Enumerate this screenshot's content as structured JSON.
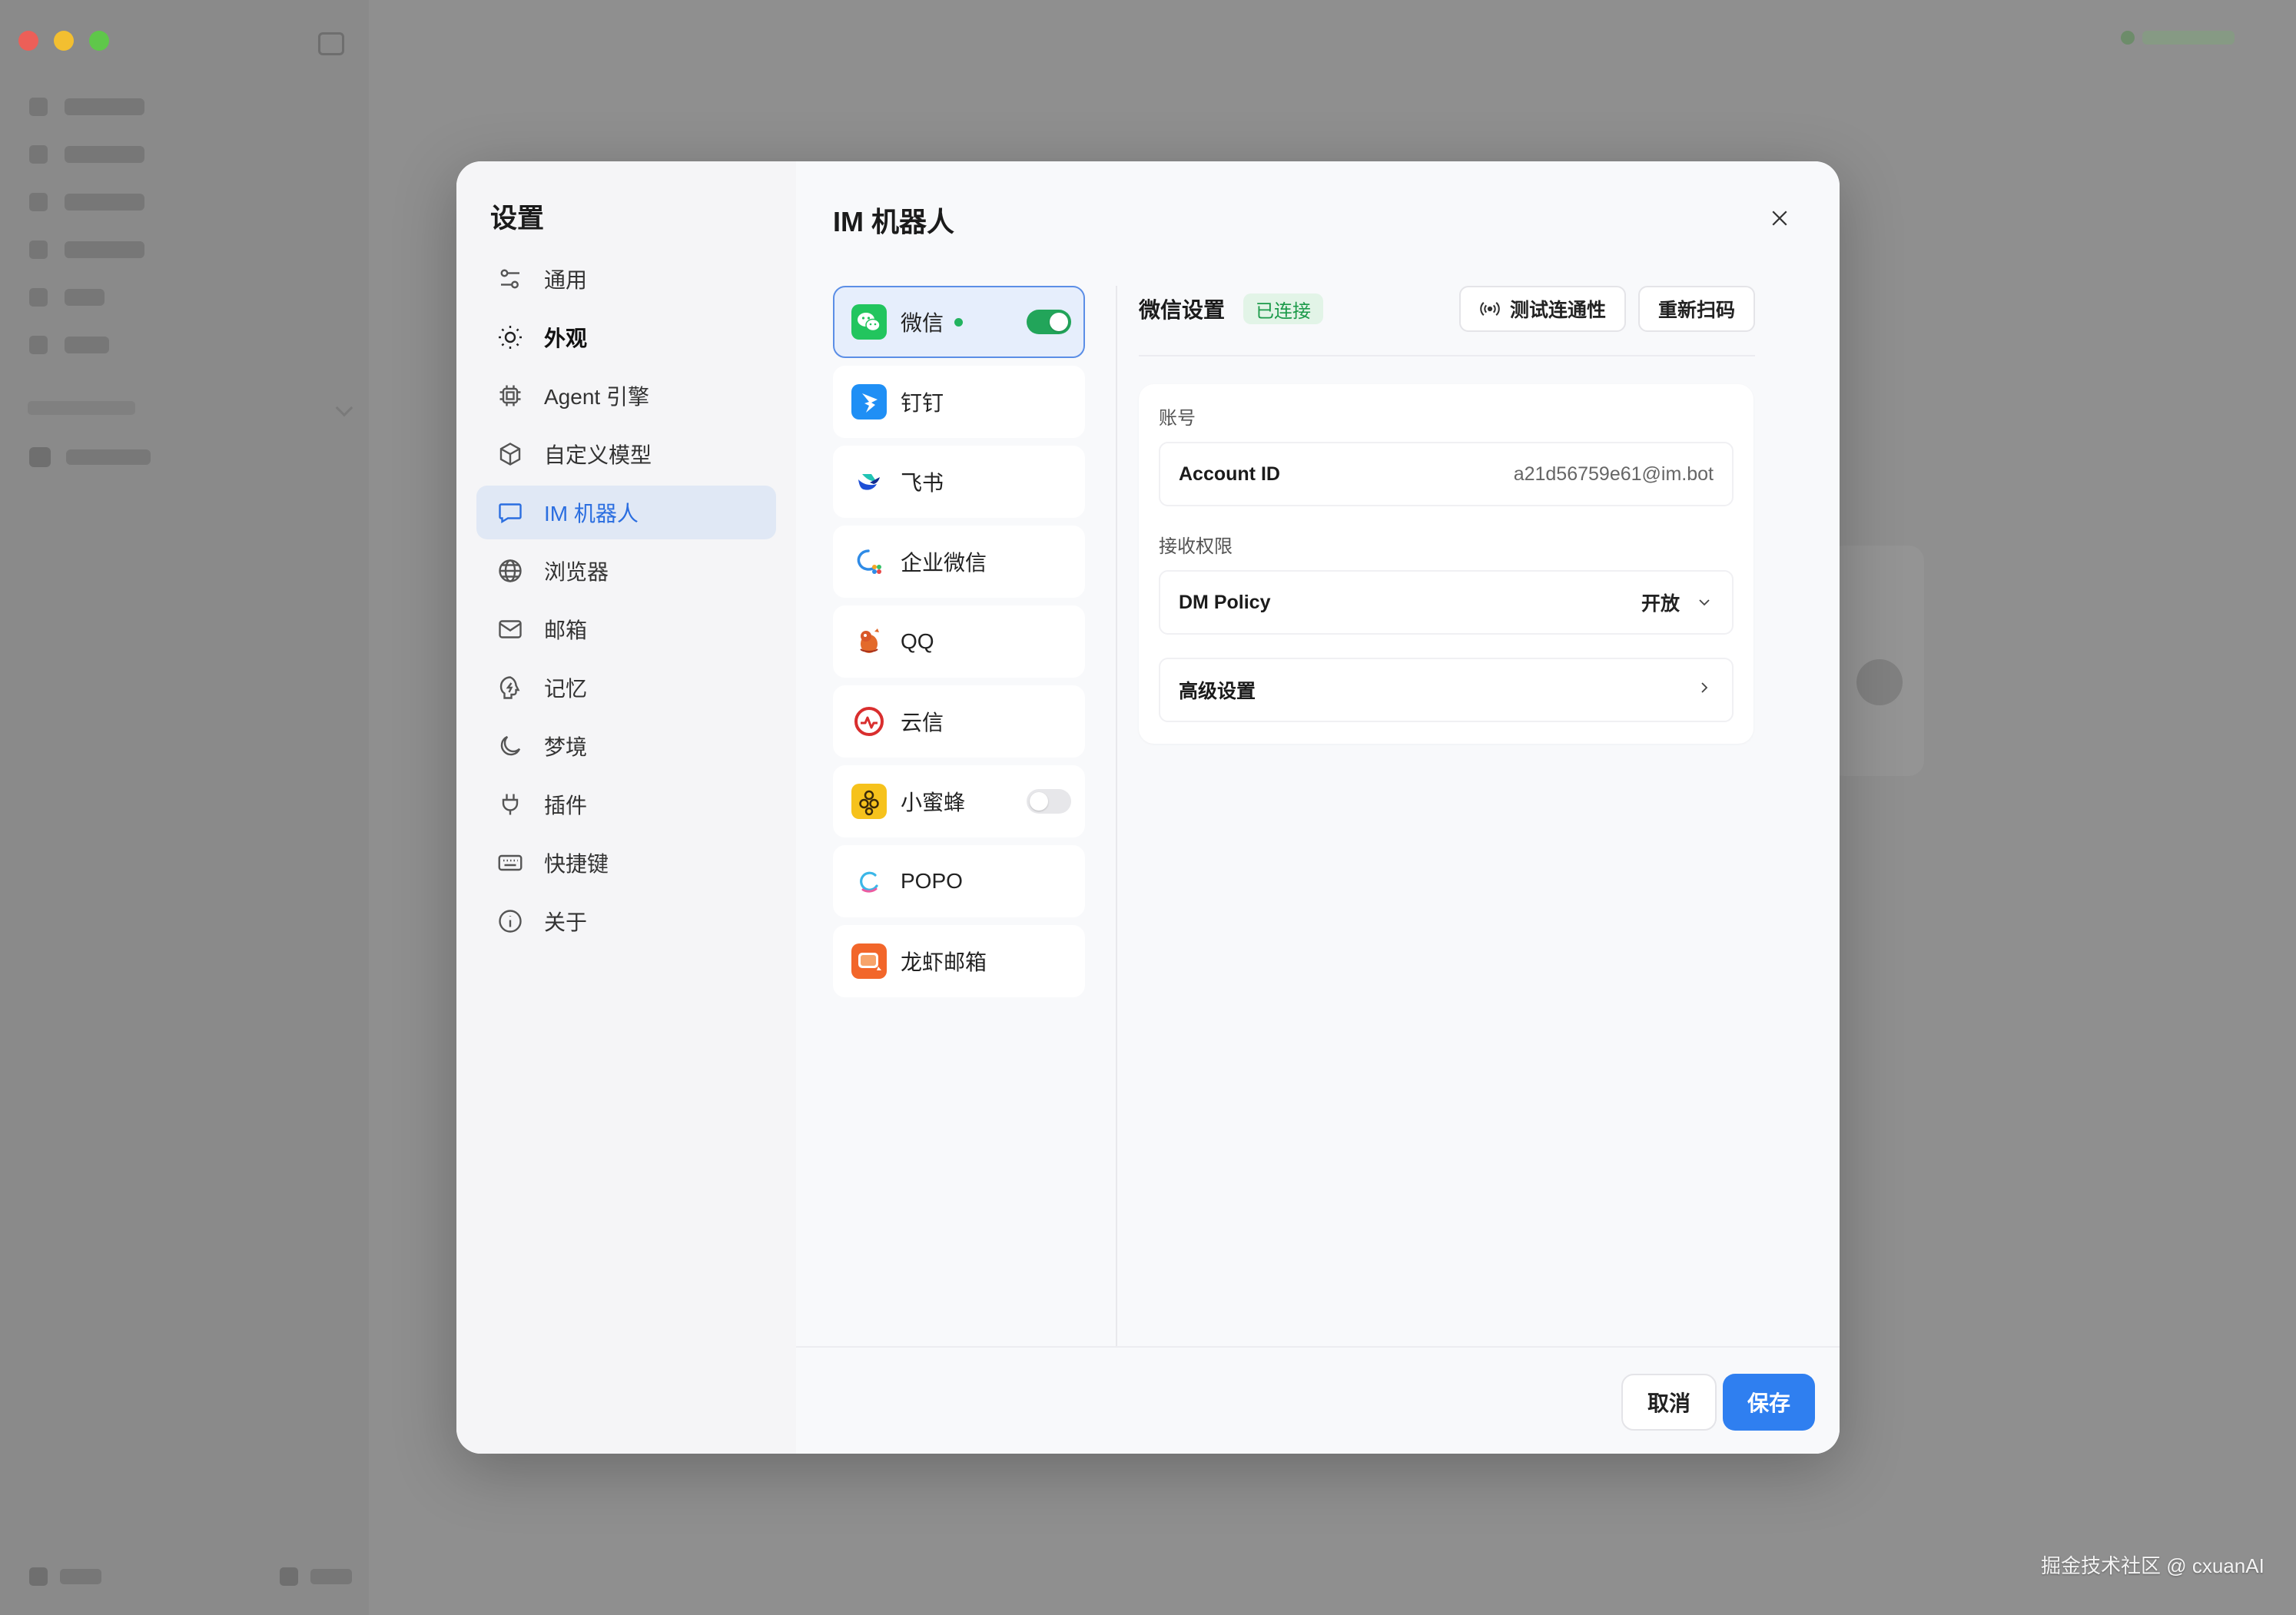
{
  "settings": {
    "title": "设置",
    "nav": [
      {
        "label": "通用",
        "icon": "sliders-icon"
      },
      {
        "label": "外观",
        "icon": "sun-icon"
      },
      {
        "label": "Agent 引擎",
        "icon": "chip-icon"
      },
      {
        "label": "自定义模型",
        "icon": "cube-icon"
      },
      {
        "label": "IM 机器人",
        "icon": "chat-bubble-icon"
      },
      {
        "label": "浏览器",
        "icon": "globe-icon"
      },
      {
        "label": "邮箱",
        "icon": "mail-icon"
      },
      {
        "label": "记忆",
        "icon": "memory-icon"
      },
      {
        "label": "梦境",
        "icon": "moon-icon"
      },
      {
        "label": "插件",
        "icon": "plug-icon"
      },
      {
        "label": "快捷键",
        "icon": "keyboard-icon"
      },
      {
        "label": "关于",
        "icon": "info-icon"
      }
    ],
    "active_nav": "IM 机器人"
  },
  "im": {
    "title": "IM 机器人",
    "platforms": [
      {
        "label": "微信",
        "icon": "wechat-icon",
        "enabled": true,
        "online": true
      },
      {
        "label": "钉钉",
        "icon": "dingtalk-icon"
      },
      {
        "label": "飞书",
        "icon": "feishu-icon"
      },
      {
        "label": "企业微信",
        "icon": "wecom-icon"
      },
      {
        "label": "QQ",
        "icon": "qq-icon"
      },
      {
        "label": "云信",
        "icon": "yunxin-icon"
      },
      {
        "label": "小蜜蜂",
        "icon": "bee-icon",
        "enabled": false
      },
      {
        "label": "POPO",
        "icon": "popo-icon"
      },
      {
        "label": "龙虾邮箱",
        "icon": "lobster-mail-icon"
      }
    ],
    "detail": {
      "title": "微信设置",
      "status": "已连接",
      "test_button": "测试连通性",
      "rescan_button": "重新扫码",
      "account_section": "账号",
      "account_label": "Account ID",
      "account_value": "a21d56759e61@im.bot",
      "permission_section": "接收权限",
      "dm_policy_label": "DM Policy",
      "dm_policy_value": "开放",
      "advanced_label": "高级设置"
    }
  },
  "footer": {
    "cancel": "取消",
    "save": "保存"
  },
  "watermark": "掘金技术社区 @ cxuanAI",
  "colors": {
    "accent": "#2f7ff0",
    "connected": "#1c9a4a",
    "toggle_on": "#22a55a"
  }
}
